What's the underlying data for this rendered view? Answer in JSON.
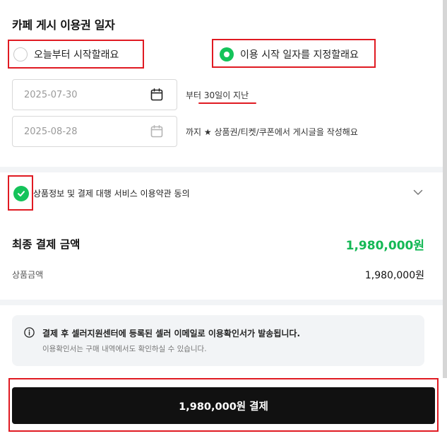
{
  "section": {
    "title": "카페 게시 이용권 일자"
  },
  "options": [
    {
      "label": "오늘부터 시작할래요",
      "selected": false
    },
    {
      "label": "이용 시작 일자를 지정할래요",
      "selected": true
    }
  ],
  "dates": {
    "start": "2025-07-30",
    "start_caption": "부터 30일이 지난",
    "end": "2025-08-28",
    "end_caption": "까지 ★ 상품권/티켓/쿠폰에서 게시글을 작성해요"
  },
  "agreement": {
    "label": "상품정보 및 결제 대행 서비스 이용약관 동의",
    "checked": true
  },
  "payment": {
    "total_label": "최종 결제 금액",
    "total_value": "1,980,000원",
    "product_label": "상품금액",
    "product_value": "1,980,000원"
  },
  "notice": {
    "main": "결제 후 셀러지원센터에 등록된 셀러 이메일로 이용확인서가 발송됩니다.",
    "sub": "이용확인서는 구매 내역에서도 확인하실 수 있습니다."
  },
  "button": {
    "label": "1,980,000원 결제"
  },
  "colors": {
    "accent_green": "#14c35a",
    "annotation_red": "#e01a22",
    "button_bg": "#111111"
  }
}
